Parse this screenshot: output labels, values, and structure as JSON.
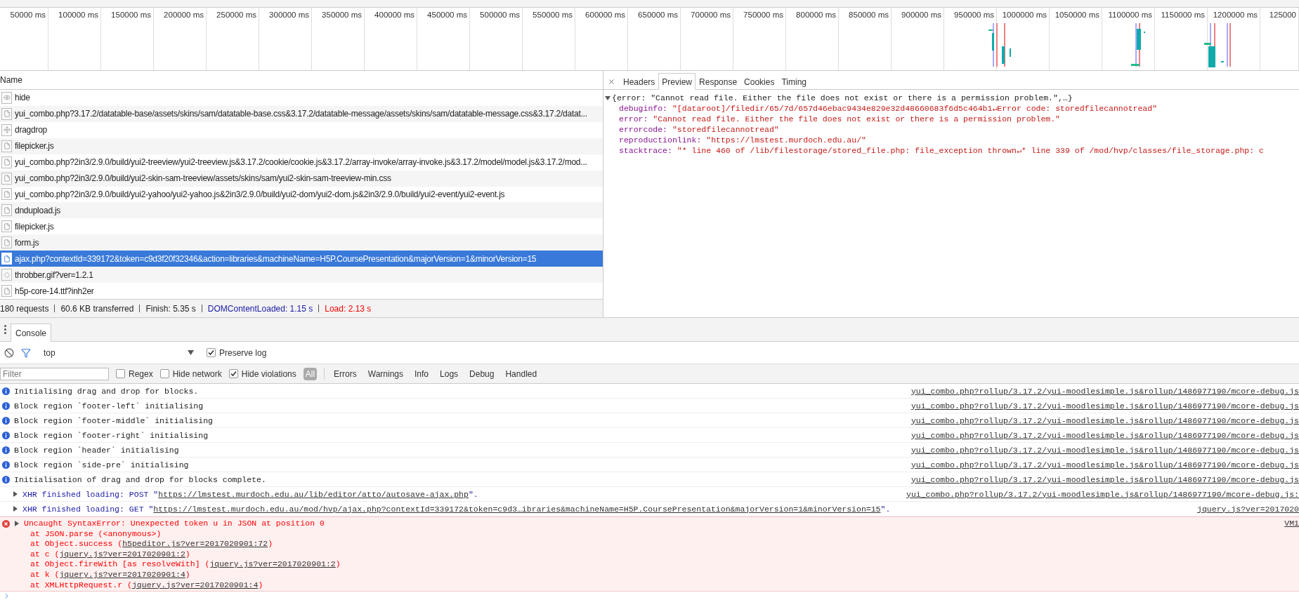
{
  "timeline": {
    "ticks": [
      "50000 ms",
      "100000 ms",
      "150000 ms",
      "200000 ms",
      "250000 ms",
      "300000 ms",
      "350000 ms",
      "400000 ms",
      "450000 ms",
      "500000 ms",
      "550000 ms",
      "600000 ms",
      "650000 ms",
      "700000 ms",
      "750000 ms",
      "800000 ms",
      "850000 ms",
      "900000 ms",
      "950000 ms",
      "1000000 ms",
      "1050000 ms",
      "1100000 ms",
      "1150000 ms",
      "1200000 ms",
      "125000"
    ]
  },
  "network": {
    "column": "Name",
    "rows": [
      {
        "name": "hide",
        "kind": "eye",
        "selected": false
      },
      {
        "name": "yui_combo.php?3.17.2/datatable-base/assets/skins/sam/datatable-base.css&3.17.2/datatable-message/assets/skins/sam/datatable-message.css&3.17.2/datat...",
        "kind": "document",
        "selected": false
      },
      {
        "name": "dragdrop",
        "kind": "move",
        "selected": false
      },
      {
        "name": "filepicker.js",
        "kind": "document",
        "selected": false
      },
      {
        "name": "yui_combo.php?2in3/2.9.0/build/yui2-treeview/yui2-treeview.js&3.17.2/cookie/cookie.js&3.17.2/array-invoke/array-invoke.js&3.17.2/model/model.js&3.17.2/mod...",
        "kind": "document",
        "selected": false
      },
      {
        "name": "yui_combo.php?2in3/2.9.0/build/yui2-skin-sam-treeview/assets/skins/sam/yui2-skin-sam-treeview-min.css",
        "kind": "document",
        "selected": false
      },
      {
        "name": "yui_combo.php?2in3/2.9.0/build/yui2-yahoo/yui2-yahoo.js&2in3/2.9.0/build/yui2-dom/yui2-dom.js&2in3/2.9.0/build/yui2-event/yui2-event.js",
        "kind": "document",
        "selected": false
      },
      {
        "name": "dndupload.js",
        "kind": "document",
        "selected": false
      },
      {
        "name": "filepicker.js",
        "kind": "document",
        "selected": false
      },
      {
        "name": "form.js",
        "kind": "document",
        "selected": false
      },
      {
        "name": "ajax.php?contextId=339172&token=c9d3f20f32346&action=libraries&machineName=H5P.CoursePresentation&majorVersion=1&minorVersion=15",
        "kind": "document",
        "selected": true
      },
      {
        "name": "throbber.gif?ver=1.2.1",
        "kind": "spinner",
        "selected": false
      },
      {
        "name": "h5p-core-14.ttf?inh2er",
        "kind": "document",
        "selected": false
      }
    ],
    "status": [
      {
        "text": "180 requests",
        "kind": "plain"
      },
      {
        "text": "60.6 KB transferred",
        "kind": "plain"
      },
      {
        "text": "Finish: 5.35 s",
        "kind": "plain"
      },
      {
        "text": "DOMContentLoaded: 1.15 s",
        "kind": "dom"
      },
      {
        "text": "Load: 2.13 s",
        "kind": "load"
      }
    ]
  },
  "detail": {
    "tabs": [
      {
        "label": "Headers",
        "selected": false
      },
      {
        "label": "Preview",
        "selected": true
      },
      {
        "label": "Response",
        "selected": false
      },
      {
        "label": "Cookies",
        "selected": false
      },
      {
        "label": "Timing",
        "selected": false
      }
    ],
    "summary": "{error: \"Cannot read file. Either the file does not exist or there is a permission problem.\",…}",
    "expanded": true,
    "properties": [
      {
        "key": "debuginfo:",
        "value": "\"[dataroot]/filedir/65/7d/657d46ebac9434e829e32d48660683f6d5c464b1↵Error code: storedfilecannotread\""
      },
      {
        "key": "error:",
        "value": "\"Cannot read file. Either the file does not exist or there is a permission problem.\""
      },
      {
        "key": "errorcode:",
        "value": "\"storedfilecannotread\""
      },
      {
        "key": "reproductionlink:",
        "value": "\"https://lmstest.murdoch.edu.au/\""
      },
      {
        "key": "stacktrace:",
        "value": "\"* line 460 of /lib/filestorage/stored_file.php: file_exception thrown↵* line 339 of /mod/hvp/classes/file_storage.php: c"
      }
    ]
  },
  "console": {
    "tab": "Console",
    "context": "top",
    "preserve_log": {
      "label": "Preserve log",
      "checked": true
    },
    "filter": {
      "placeholder": "Filter"
    },
    "options": [
      {
        "label": "Regex",
        "checked": false
      },
      {
        "label": "Hide network",
        "checked": false
      },
      {
        "label": "Hide violations",
        "checked": true
      }
    ],
    "levels": [
      {
        "label": "All",
        "selected": true
      },
      {
        "label": "Errors",
        "selected": false
      },
      {
        "label": "Warnings",
        "selected": false
      },
      {
        "label": "Info",
        "selected": false
      },
      {
        "label": "Logs",
        "selected": false
      },
      {
        "label": "Debug",
        "selected": false
      },
      {
        "label": "Handled",
        "selected": false
      }
    ],
    "messages": [
      {
        "kind": "info",
        "text": "Initialising drag and drop for blocks.",
        "source": "yui_combo.php?rollup/3.17.2/yui-moodlesimple.js&rollup/1486977190/mcore-debug.js"
      },
      {
        "kind": "info",
        "text": "Block region `footer-left` initialising",
        "source": "yui_combo.php?rollup/3.17.2/yui-moodlesimple.js&rollup/1486977190/mcore-debug.js"
      },
      {
        "kind": "info",
        "text": "Block region `footer-middle` initialising",
        "source": "yui_combo.php?rollup/3.17.2/yui-moodlesimple.js&rollup/1486977190/mcore-debug.js"
      },
      {
        "kind": "info",
        "text": "Block region `footer-right` initialising",
        "source": "yui_combo.php?rollup/3.17.2/yui-moodlesimple.js&rollup/1486977190/mcore-debug.js"
      },
      {
        "kind": "info",
        "text": "Block region `header` initialising",
        "source": "yui_combo.php?rollup/3.17.2/yui-moodlesimple.js&rollup/1486977190/mcore-debug.js"
      },
      {
        "kind": "info",
        "text": "Block region `side-pre` initialising",
        "source": "yui_combo.php?rollup/3.17.2/yui-moodlesimple.js&rollup/1486977190/mcore-debug.js"
      },
      {
        "kind": "info",
        "text": "Initialisation of drag and drop for blocks complete.",
        "source": "yui_combo.php?rollup/3.17.2/yui-moodlesimple.js&rollup/1486977190/mcore-debug.js"
      },
      {
        "kind": "xhr",
        "prefix": "XHR finished loading: POST \"",
        "url": "https://lmstest.murdoch.edu.au/lib/editor/atto/autosave-ajax.php",
        "suffix": "\".",
        "source": "yui_combo.php?rollup/3.17.2/yui-moodlesimple.js&rollup/1486977190/mcore-debug.js:"
      },
      {
        "kind": "xhr",
        "prefix": "XHR finished loading: GET \"",
        "url": "https://lmstest.murdoch.edu.au/mod/hvp/ajax.php?contextId=339172&token=c9d3…ibraries&machineName=H5P.CoursePresentation&majorVersion=1&minorVersion=15",
        "suffix": "\".",
        "source": "jquery.js?ver=2017020"
      },
      {
        "kind": "error",
        "text": "Uncaught SyntaxError: Unexpected token u in JSON at position 0",
        "source": "VM1",
        "stack": [
          {
            "prefix": "at JSON.parse (<anonymous>)"
          },
          {
            "prefix": "at Object.success (",
            "link": "h5peditor.js?ver=2017020901:72",
            "suffix": ")"
          },
          {
            "prefix": "at c (",
            "link": "jquery.js?ver=2017020901:2",
            "suffix": ")"
          },
          {
            "prefix": "at Object.fireWith [as resolveWith] (",
            "link": "jquery.js?ver=2017020901:2",
            "suffix": ")"
          },
          {
            "prefix": "at k (",
            "link": "jquery.js?ver=2017020901:4",
            "suffix": ")"
          },
          {
            "prefix": "at XMLHttpRequest.r (",
            "link": "jquery.js?ver=2017020901:4",
            "suffix": ")"
          }
        ]
      }
    ]
  }
}
